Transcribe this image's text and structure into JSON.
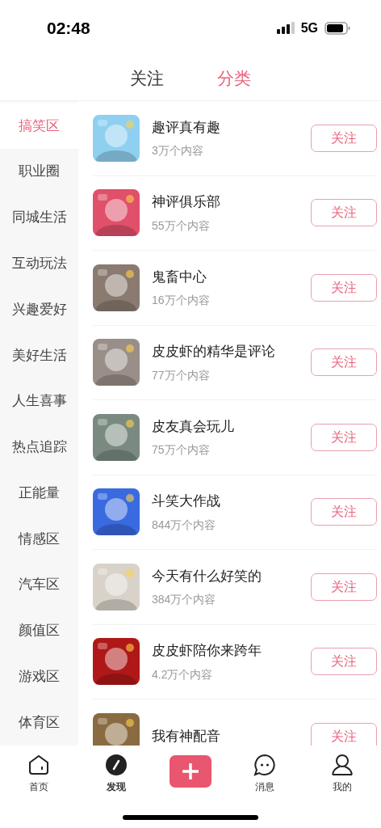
{
  "status_bar": {
    "time": "02:48",
    "network": "5G"
  },
  "tabs": [
    {
      "label": "关注",
      "selected": false
    },
    {
      "label": "分类",
      "selected": true
    }
  ],
  "sidebar": {
    "items": [
      {
        "label": "搞笑区",
        "selected": true
      },
      {
        "label": "职业圈",
        "selected": false
      },
      {
        "label": "同城生活",
        "selected": false
      },
      {
        "label": "互动玩法",
        "selected": false
      },
      {
        "label": "兴趣爱好",
        "selected": false
      },
      {
        "label": "美好生活",
        "selected": false
      },
      {
        "label": "人生喜事",
        "selected": false
      },
      {
        "label": "热点追踪",
        "selected": false
      },
      {
        "label": "正能量",
        "selected": false
      },
      {
        "label": "情感区",
        "selected": false
      },
      {
        "label": "汽车区",
        "selected": false
      },
      {
        "label": "颜值区",
        "selected": false
      },
      {
        "label": "游戏区",
        "selected": false
      },
      {
        "label": "体育区",
        "selected": false
      }
    ]
  },
  "topics": [
    {
      "name": "趣评真有趣",
      "count": "3万个内容",
      "button": "关注",
      "color": "#8fd0f0"
    },
    {
      "name": "神评俱乐部",
      "count": "55万个内容",
      "button": "关注",
      "color": "#e0506a"
    },
    {
      "name": "鬼畜中心",
      "count": "16万个内容",
      "button": "关注",
      "color": "#8a7a70"
    },
    {
      "name": "皮皮虾的精华是评论",
      "count": "77万个内容",
      "button": "关注",
      "color": "#9a8e88"
    },
    {
      "name": "皮友真会玩儿",
      "count": "75万个内容",
      "button": "关注",
      "color": "#7a8a80"
    },
    {
      "name": "斗笑大作战",
      "count": "844万个内容",
      "button": "关注",
      "color": "#3a6ae0"
    },
    {
      "name": "今天有什么好笑的",
      "count": "384万个内容",
      "button": "关注",
      "color": "#d8d2c8"
    },
    {
      "name": "皮皮虾陪你来跨年",
      "count": "4.2万个内容",
      "button": "关注",
      "color": "#b01818"
    },
    {
      "name": "我有神配音",
      "button": "关注",
      "color": "#8a6a40"
    }
  ],
  "bottom_nav": [
    {
      "label": "首页",
      "kind": "home",
      "selected": false
    },
    {
      "label": "发现",
      "kind": "discover",
      "selected": true
    },
    {
      "kind": "add",
      "selected": false
    },
    {
      "label": "消息",
      "kind": "message",
      "selected": false
    },
    {
      "label": "我的",
      "kind": "profile",
      "selected": false
    }
  ]
}
